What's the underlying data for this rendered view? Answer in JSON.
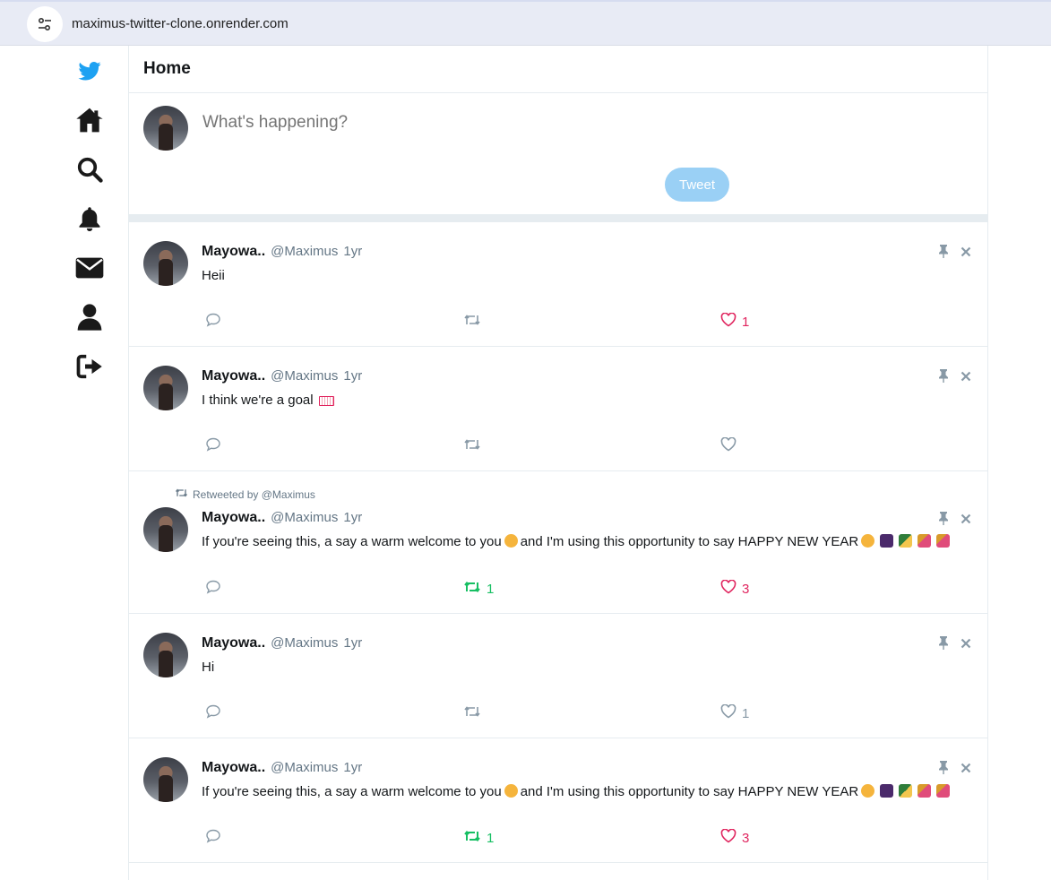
{
  "browser": {
    "url": "maximus-twitter-clone.onrender.com"
  },
  "nav": {
    "icons": [
      "twitter-bird-icon",
      "home-icon",
      "search-icon",
      "bell-icon",
      "mail-icon",
      "user-icon",
      "logout-icon"
    ]
  },
  "header": {
    "title": "Home"
  },
  "composer": {
    "placeholder": "What's happening?",
    "button_label": "Tweet"
  },
  "colors": {
    "brand": "#1da1f2",
    "like": "#e0245e",
    "retweet": "#17bf63",
    "muted": "#8899a6"
  },
  "posts": [
    {
      "name": "Mayowa..",
      "handle": "@Maximus",
      "time": "1yr",
      "text": "Heii",
      "retweet_count": "",
      "like_count": "1",
      "liked": true,
      "retweeted": false
    },
    {
      "name": "Mayowa..",
      "handle": "@Maximus",
      "time": "1yr",
      "text": "I think we're a goal",
      "retweet_count": "",
      "like_count": "",
      "liked": false,
      "retweeted": false
    },
    {
      "retweeted_by": "Retweeted by @Maximus",
      "name": "Mayowa..",
      "handle": "@Maximus",
      "time": "1yr",
      "text_a": "If you're seeing this, a say a warm welcome to you",
      "text_b": "and I'm using this opportunity to say HAPPY NEW YEAR",
      "retweet_count": "1",
      "like_count": "3",
      "liked": true,
      "retweeted": true
    },
    {
      "name": "Mayowa..",
      "handle": "@Maximus",
      "time": "1yr",
      "text": "Hi",
      "retweet_count": "",
      "like_count": "1",
      "liked": false,
      "retweeted": false
    },
    {
      "name": "Mayowa..",
      "handle": "@Maximus",
      "time": "1yr",
      "text_a": "If you're seeing this, a say a warm welcome to you",
      "text_b": "and I'm using this opportunity to say HAPPY NEW YEAR",
      "retweet_count": "1",
      "like_count": "3",
      "liked": true,
      "retweeted": true
    }
  ]
}
